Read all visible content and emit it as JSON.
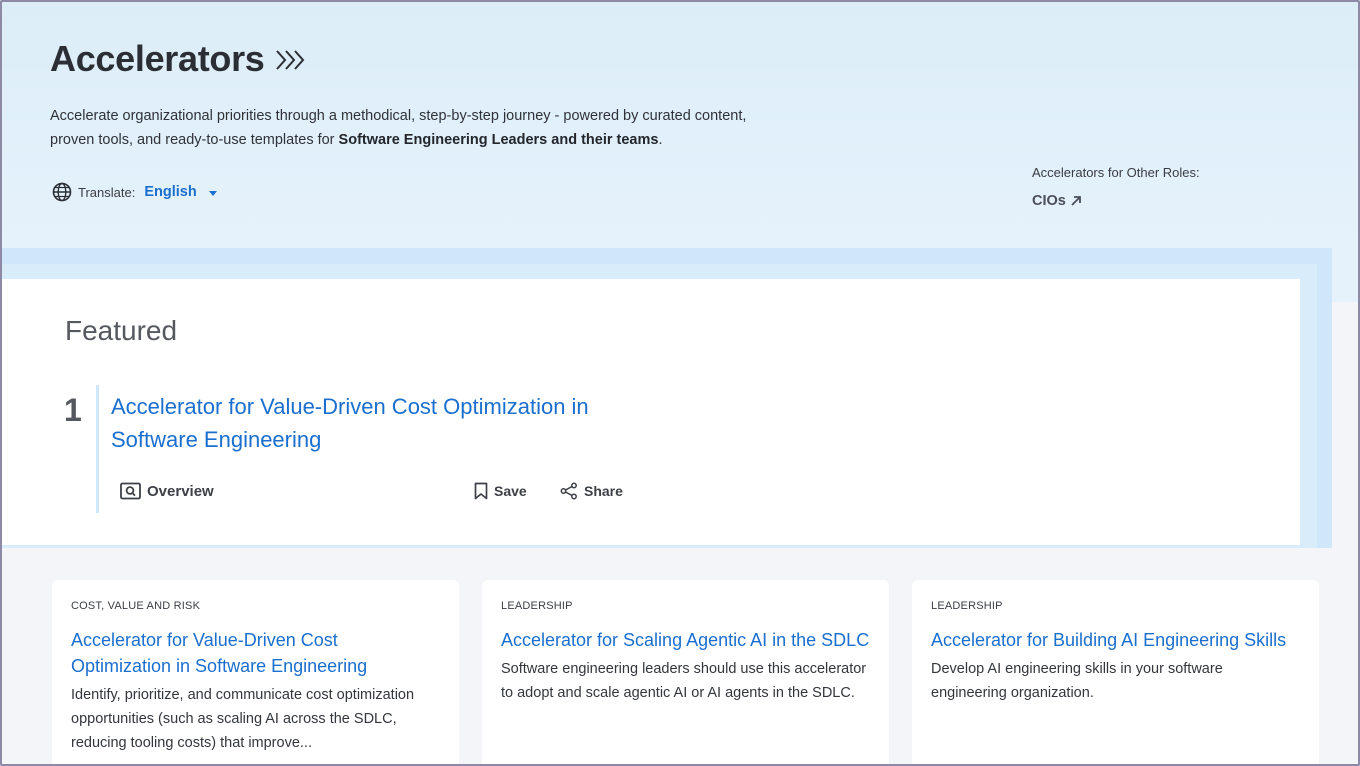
{
  "header": {
    "title": "Accelerators",
    "description_plain": "Accelerate organizational priorities through a methodical, step-by-step journey - powered by curated content, proven tools, and ready-to-use templates for ",
    "description_bold": "Software Engineering Leaders and their teams",
    "description_end": ".",
    "translate_label": "Translate:",
    "translate_value": "English",
    "other_roles_label": "Accelerators for Other Roles:",
    "other_roles_link": "CIOs"
  },
  "featured": {
    "heading": "Featured",
    "number": "1",
    "title": "Accelerator for Value-Driven Cost Optimization in Software Engineering",
    "overview_label": "Overview",
    "save_label": "Save",
    "share_label": "Share"
  },
  "cards": [
    {
      "category": "COST, VALUE AND RISK",
      "title": "Accelerator for Value-Driven Cost Optimization in Software Engineering",
      "description": "Identify, prioritize, and communicate cost optimization opportunities (such as scaling AI across the SDLC, reducing tooling costs) that improve..."
    },
    {
      "category": "LEADERSHIP",
      "title": "Accelerator for Scaling Agentic AI in the SDLC",
      "description": "Software engineering leaders should use this accelerator to adopt and scale agentic AI or AI agents in the SDLC."
    },
    {
      "category": "LEADERSHIP",
      "title": "Accelerator for Building AI Engineering Skills",
      "description": "Develop AI engineering skills in your software engineering organization."
    }
  ],
  "colors": {
    "accent": "#1a6fcf",
    "hero_bg": "#dcedf8",
    "frame": "#8e8aa6"
  },
  "icons": [
    "chevrons-right-icon",
    "globe-icon",
    "caret-down-icon",
    "arrow-up-right-icon",
    "overview-icon",
    "bookmark-icon",
    "share-icon"
  ]
}
